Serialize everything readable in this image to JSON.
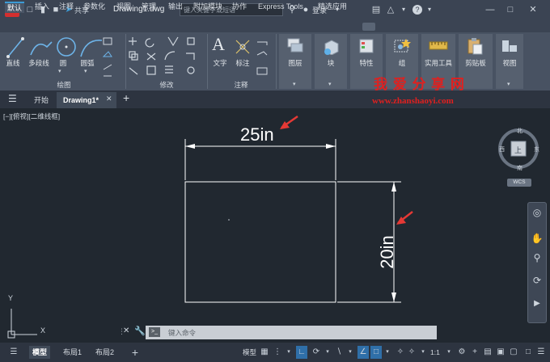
{
  "titlebar": {
    "app_logo": "A",
    "share": "共享",
    "doc_title": "Drawing1.dwg",
    "search_placeholder": "键入关键字或短语",
    "login": "登录"
  },
  "ribbon_tabs": [
    "默认",
    "插入",
    "注释",
    "参数化",
    "视图",
    "管理",
    "输出",
    "附加模块",
    "协作",
    "Express Tools",
    "精选应用"
  ],
  "ribbon": {
    "draw_tools": [
      "直线",
      "多段线",
      "圆",
      "圆弧"
    ],
    "draw_panel": "绘图",
    "modify_panel": "修改",
    "annotation_tools": [
      "文字",
      "标注"
    ],
    "annotation_panel": "注释",
    "layers": "图层",
    "block": "块",
    "properties": "特性",
    "group": "组",
    "utilities": "实用工具",
    "clipboard": "剪贴板",
    "view": "视图"
  },
  "watermark": {
    "title": "我 爱 分 享 网",
    "url": "www.zhanshaoyi.com"
  },
  "doc_tabs": {
    "start": "开始",
    "drawing": "Drawing1*",
    "add": "+"
  },
  "viewport": {
    "view_label": "[−][俯视][二维线框]",
    "dim_horizontal": "25in",
    "dim_vertical": "20in",
    "axis_y": "Y",
    "axis_x": "X"
  },
  "viewcube": {
    "north": "北",
    "south": "南",
    "east": "东",
    "west": "西",
    "top": "上",
    "wcs": "WCS"
  },
  "command": {
    "placeholder": "键入命令"
  },
  "statusbar": {
    "tabs": [
      "模型",
      "布局1",
      "布局2"
    ],
    "model_button": "模型",
    "scale": "1:1"
  },
  "colors": {
    "accent": "#3c9bd6",
    "arrow_red": "#e53935",
    "watermark_red": "#e0201f",
    "dimension_line": "#ffffff",
    "background": "#212830"
  }
}
